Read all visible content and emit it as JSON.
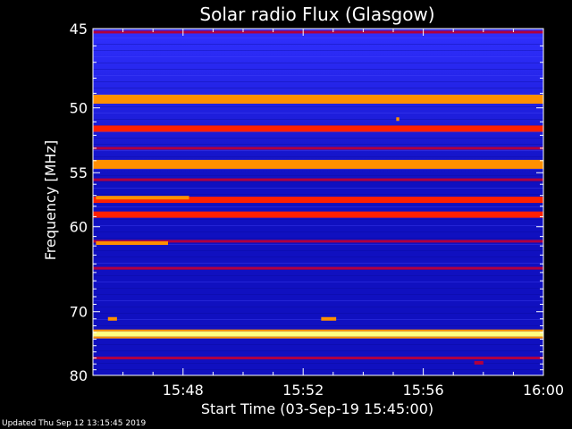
{
  "chart_data": {
    "type": "heatmap",
    "title": "Solar radio Flux (Glasgow)",
    "xlabel": "Start Time (03-Sep-19 15:45:00)",
    "ylabel": "Frequency [MHz]",
    "x_ticks": [
      "15:48",
      "15:52",
      "15:56",
      "16:00"
    ],
    "x_tick_minutes": [
      3,
      7,
      11,
      15
    ],
    "xlim_minutes": [
      0,
      15
    ],
    "y_ticks": [
      45,
      50,
      55,
      60,
      70,
      80
    ],
    "ylim": [
      45,
      80
    ],
    "y_scale": "reciprocal",
    "colormap": [
      "#000050",
      "#1010c0",
      "#3030ff",
      "#b00040",
      "#ff2000",
      "#ff9000",
      "#ffff80"
    ],
    "bands": [
      {
        "freq_mhz": 45.2,
        "level": "low"
      },
      {
        "freq_mhz": 49.4,
        "level": "high"
      },
      {
        "freq_mhz": 51.5,
        "level": "medium"
      },
      {
        "freq_mhz": 53.0,
        "level": "low"
      },
      {
        "freq_mhz": 54.3,
        "level": "high"
      },
      {
        "freq_mhz": 55.6,
        "level": "low"
      },
      {
        "freq_mhz": 57.4,
        "level": "medium"
      },
      {
        "freq_mhz": 58.8,
        "level": "medium"
      },
      {
        "freq_mhz": 61.5,
        "level": "low"
      },
      {
        "freq_mhz": 64.5,
        "level": "low"
      },
      {
        "freq_mhz": 73.2,
        "level": "saturated"
      },
      {
        "freq_mhz": 77.0,
        "level": "low"
      }
    ],
    "bursts": [
      {
        "start_min": 0.1,
        "end_min": 3.2,
        "freq_mhz": 57.2,
        "level": "high"
      },
      {
        "start_min": 0.1,
        "end_min": 2.5,
        "freq_mhz": 61.7,
        "level": "high"
      },
      {
        "start_min": 0.5,
        "end_min": 0.8,
        "freq_mhz": 71.0,
        "level": "high"
      },
      {
        "start_min": 7.6,
        "end_min": 8.1,
        "freq_mhz": 71.0,
        "level": "high"
      },
      {
        "start_min": 10.1,
        "end_min": 10.2,
        "freq_mhz": 50.8,
        "level": "high"
      },
      {
        "start_min": 12.7,
        "end_min": 13.0,
        "freq_mhz": 77.8,
        "level": "low"
      }
    ]
  },
  "footer": "Updated Thu Sep 12 13:15:45 2019"
}
